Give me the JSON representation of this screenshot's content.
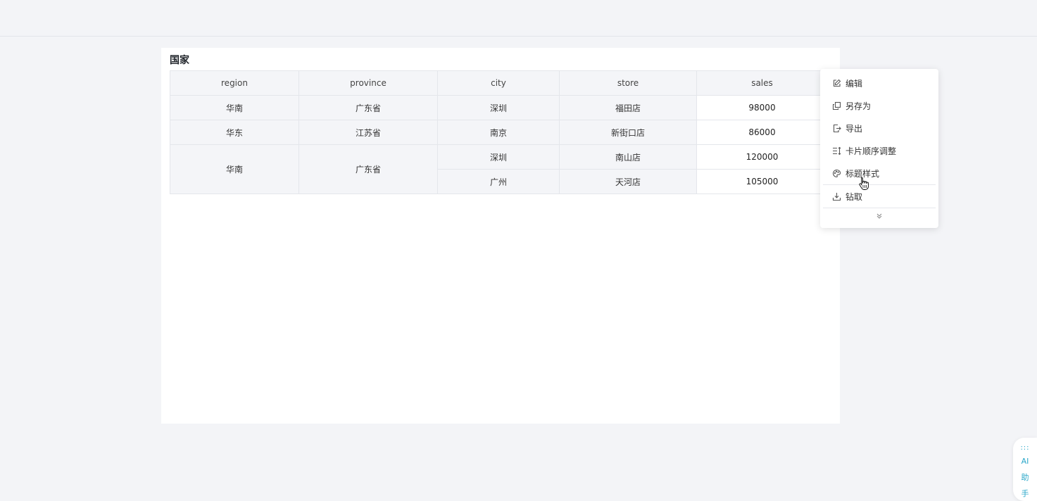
{
  "card": {
    "title": "国家"
  },
  "table": {
    "headers": [
      "region",
      "province",
      "city",
      "store",
      "sales"
    ],
    "rows": [
      {
        "region": "华南",
        "province": "广东省",
        "city": "深圳",
        "store": "福田店",
        "sales": "98000"
      },
      {
        "region": "华东",
        "province": "江苏省",
        "city": "南京",
        "store": "新街口店",
        "sales": "86000"
      },
      {
        "region": "华南",
        "province": "广东省",
        "city": "深圳",
        "store": "南山店",
        "sales": "120000"
      },
      {
        "region": "",
        "province": "",
        "city": "广州",
        "store": "天河店",
        "sales": "105000"
      }
    ]
  },
  "menu": {
    "items": [
      {
        "label": "编辑",
        "icon": "edit-icon"
      },
      {
        "label": "另存为",
        "icon": "copy-icon"
      },
      {
        "label": "导出",
        "icon": "export-icon"
      },
      {
        "label": "卡片顺序调整",
        "icon": "sort-icon"
      },
      {
        "label": "标题样式",
        "icon": "palette-icon"
      },
      {
        "label": "钻取",
        "icon": "drill-icon"
      }
    ],
    "more_icon": "double-chevron-down-icon"
  },
  "ai_tab": {
    "dots": ":::",
    "label_1": "AI",
    "label_2": "助",
    "label_3": "手"
  },
  "colors": {
    "accent": "#2aa7c9",
    "header_bg": "#f4f5f8",
    "border": "#e4e6eb"
  }
}
